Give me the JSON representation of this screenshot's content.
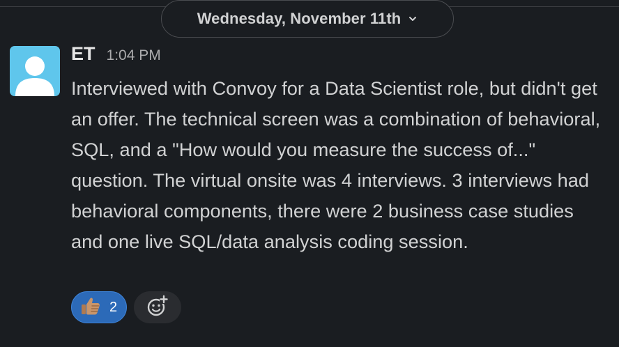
{
  "date_divider": {
    "label": "Wednesday, November 11th",
    "chevron_icon": "chevron-down-icon"
  },
  "message": {
    "avatar_icon": "default-user-avatar-icon",
    "author": "ET",
    "time": "1:04 PM",
    "text": "Interviewed with Convoy for a Data Scientist role, but didn't get an offer. The technical screen was a combination of behavioral, SQL, and a \"How would you measure the success of...\" question. The virtual onsite was 4 interviews. 3 interviews had behavioral components, there were 2 business case studies and one live SQL/data analysis coding session."
  },
  "reactions": [
    {
      "icon": "thumbs-up-icon",
      "count": "2",
      "active": true
    }
  ],
  "add_reaction": {
    "icon": "add-reaction-icon"
  },
  "colors": {
    "background": "#1a1d21",
    "text": "#d1d2d3",
    "avatar": "#5fc6ec",
    "reaction_active": "#2c6ab8"
  }
}
